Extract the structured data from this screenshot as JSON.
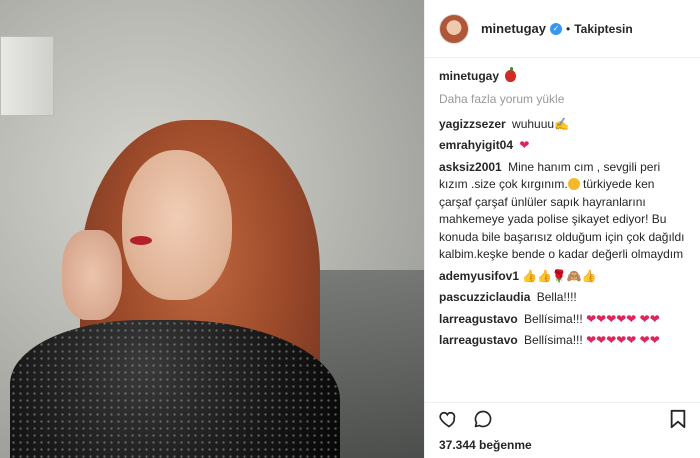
{
  "header": {
    "username": "minetugay",
    "verified_icon": "verified-badge-icon",
    "separator": "•",
    "follow_label": "Takiptesin"
  },
  "caption": {
    "username": "minetugay",
    "emoji": "apple-icon"
  },
  "load_more": "Daha fazla yorum yükle",
  "comments": [
    {
      "user": "yagizzsezer",
      "text": "wuhuuu",
      "emoji": "✍"
    },
    {
      "user": "emrahyigit04",
      "text": "",
      "emoji": "❤"
    },
    {
      "user": "asksiz2001",
      "text_a": "Mine hanım cım , sevgili peri kızım .size çok kırgınım.",
      "text_b": "türkiyede ken çarşaf çarşaf ünlüler sapık hayranlarını mahkemeye yada polise şikayet ediyor! Bu konuda bile başarısız olduğum için çok dağıldı kalbim.keşke bende o kadar değerli olmaydım"
    },
    {
      "user": "ademyusifov1",
      "text": "",
      "emoji": "👍👍🌹🙈👍"
    },
    {
      "user": "pascuzziclaudia",
      "text": "Bella!!!!",
      "emoji": ""
    },
    {
      "user": "larreagustavo",
      "text": "Bellísima!!!",
      "emoji": "❤❤❤❤❤ ❤❤"
    },
    {
      "user": "larreagustavo",
      "text": "Bellísima!!!",
      "emoji": "❤❤❤❤❤ ❤❤"
    }
  ],
  "actions": {
    "like_icon": "heart-outline-icon",
    "comment_icon": "comment-bubble-icon",
    "save_icon": "bookmark-icon"
  },
  "likes": "37.344 beğenme",
  "colors": {
    "verified": "#3897f0",
    "heart": "#e0245e",
    "muted_text": "#999999"
  }
}
